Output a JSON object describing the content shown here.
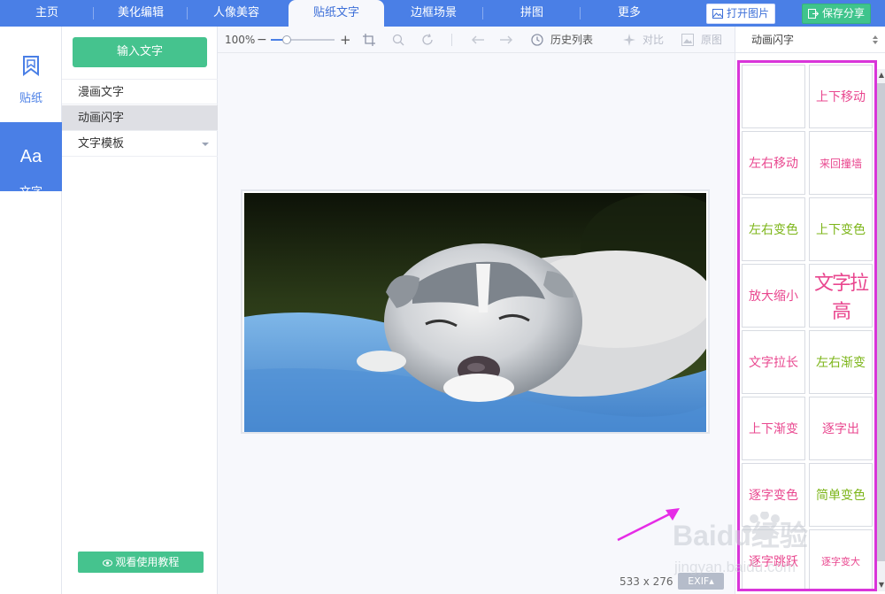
{
  "nav": {
    "tabs": [
      {
        "label": "主页"
      },
      {
        "label": "美化编辑"
      },
      {
        "label": "人像美容"
      },
      {
        "label": "贴纸文字"
      },
      {
        "label": "边框场景"
      },
      {
        "label": "拼图"
      },
      {
        "label": "更多"
      }
    ],
    "active_tab": "贴纸文字",
    "open_image": "打开图片",
    "save_share": "保存分享"
  },
  "categories": {
    "sticker_label": "贴纸",
    "text_label": "文字",
    "text_icon_glyph": "Aa"
  },
  "panel": {
    "input_text_button": "输入文字",
    "menu": [
      "漫画文字",
      "动画闪字",
      "文字模板"
    ],
    "selected": "动画闪字",
    "tutorial_button": "观看使用教程"
  },
  "toolbar": {
    "zoom": "100%",
    "zoom_fraction": 0.25,
    "history": "历史列表",
    "compare": "对比",
    "original": "原图"
  },
  "canvas": {
    "image_size": "533 x 276",
    "exif": "EXIF"
  },
  "effects": {
    "dropdown_value": "动画闪字",
    "items": [
      {
        "label": "",
        "color": "#e9478f"
      },
      {
        "label": "上下移动",
        "color": "#e9478f"
      },
      {
        "label": "左右移动",
        "color": "#e9478f"
      },
      {
        "label": "来回撞墙",
        "color": "#e9478f"
      },
      {
        "label": "左右变色",
        "color": "#7cb518"
      },
      {
        "label": "上下变色",
        "color": "#7cb518"
      },
      {
        "label": "放大缩小",
        "color": "#e9478f"
      },
      {
        "label": "文字拉高",
        "color": "#e9478f"
      },
      {
        "label": "文字拉长",
        "color": "#e9478f"
      },
      {
        "label": "左右渐变",
        "color": "#7cb518"
      },
      {
        "label": "上下渐变",
        "color": "#e9478f"
      },
      {
        "label": "逐字出",
        "color": "#e9478f"
      },
      {
        "label": "逐字变色",
        "color": "#e9478f"
      },
      {
        "label": "简单变色",
        "color": "#7cb518"
      },
      {
        "label": "逐字跳跃",
        "color": "#e9478f"
      },
      {
        "label": "逐字变大",
        "color": "#e9478f"
      }
    ]
  },
  "watermark": {
    "brand": "Baidu经验",
    "url": "jingyan.baidu.com"
  },
  "colors": {
    "nav_blue": "#4a7fe6",
    "green": "#45c38e",
    "highlight_magenta": "#d935d9"
  }
}
